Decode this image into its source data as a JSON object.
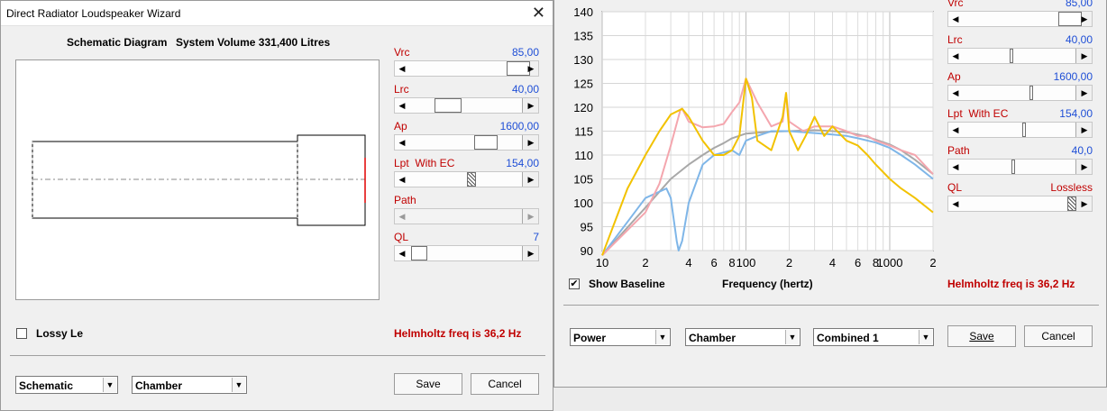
{
  "left": {
    "title": "Direct Radiator Loudspeaker Wizard",
    "diagram_label": "Schematic Diagram",
    "system_volume": "System Volume 331,400 Litres",
    "params": [
      {
        "label": "Vrc",
        "value": "85,00"
      },
      {
        "label": "Lrc",
        "value": "40,00"
      },
      {
        "label": "Ap",
        "value": "1600,00"
      },
      {
        "label": "Lpt  With EC",
        "value": "154,00"
      },
      {
        "label": "Path",
        "value": ""
      },
      {
        "label": "QL",
        "value": "7"
      }
    ],
    "lossy_label": "Lossy Le",
    "helmholtz": "Helmholtz freq is 36,2 Hz",
    "combo1": "Schematic",
    "combo2": "Chamber",
    "save": "Save",
    "cancel": "Cancel"
  },
  "right": {
    "params": [
      {
        "label": "Vrc",
        "value": "85,00"
      },
      {
        "label": "Lrc",
        "value": "40,00"
      },
      {
        "label": "Ap",
        "value": "1600,00"
      },
      {
        "label": "Lpt  With EC",
        "value": "154,00"
      },
      {
        "label": "Path",
        "value": "40,0"
      },
      {
        "label": "QL",
        "value": "Lossless"
      }
    ],
    "show_baseline": "Show Baseline",
    "xlabel": "Frequency (hertz)",
    "helmholtz": "Helmholtz freq is 36,2 Hz",
    "combo1": "Power",
    "combo2": "Chamber",
    "combo3": "Combined 1",
    "save": "Save",
    "cancel": "Cancel"
  },
  "chart_data": {
    "type": "line",
    "title": "",
    "xlabel": "Frequency (hertz)",
    "ylabel": "",
    "x_scale": "log",
    "xlim": [
      10,
      2000
    ],
    "ylim": [
      90,
      140
    ],
    "y_ticks": [
      "140",
      "135",
      "130",
      "125",
      "120",
      "115",
      "110",
      "105",
      "100",
      "95",
      "90"
    ],
    "x_ticks": [
      "10",
      "2",
      "4",
      "6",
      "8",
      "100",
      "2",
      "4",
      "6",
      "8",
      "1000",
      "2"
    ],
    "grid": true,
    "colors": {
      "gold": "#f2c200",
      "pink": "#f4a6ae",
      "blue": "#7fb6e8",
      "gray": "#a8a8a8"
    },
    "series": [
      {
        "color": "gold",
        "x": [
          10,
          15,
          20,
          25,
          30,
          35,
          36,
          40,
          50,
          60,
          70,
          80,
          90,
          100,
          110,
          120,
          150,
          180,
          190,
          200,
          230,
          260,
          300,
          350,
          400,
          500,
          600,
          700,
          800,
          1000,
          1200,
          1500,
          2000
        ],
        "y": [
          89,
          103,
          110,
          115,
          118.5,
          119.5,
          119.7,
          118,
          113,
          110,
          110,
          111,
          114,
          126,
          122,
          113,
          111,
          118,
          123,
          115,
          111,
          114,
          118,
          114,
          116,
          113,
          112,
          110,
          108,
          105,
          103,
          101,
          98
        ]
      },
      {
        "color": "pink",
        "x": [
          10,
          20,
          25,
          30,
          35,
          36,
          40,
          50,
          60,
          70,
          80,
          90,
          100,
          120,
          150,
          180,
          190,
          200,
          250,
          300,
          400,
          500,
          600,
          700,
          800,
          1000,
          1200,
          1500,
          2000
        ],
        "y": [
          89,
          98,
          104,
          112,
          119.5,
          119.7,
          117,
          115.8,
          116,
          116.5,
          119,
          121,
          126,
          121,
          116,
          117,
          123,
          117,
          115,
          116,
          116,
          115,
          114,
          114,
          113,
          112,
          111,
          110,
          106
        ]
      },
      {
        "color": "blue",
        "x": [
          10,
          15,
          20,
          28,
          30,
          33,
          34,
          36,
          40,
          50,
          60,
          80,
          90,
          100,
          120,
          150,
          200,
          300,
          400,
          500,
          600,
          800,
          1000,
          1200,
          1500,
          2000
        ],
        "y": [
          89,
          96,
          101,
          103,
          101,
          92,
          90,
          92,
          100,
          108,
          110,
          111,
          110,
          113,
          114,
          115,
          115,
          114.6,
          114.3,
          114,
          113.5,
          112.6,
          111.5,
          110,
          108,
          105
        ]
      },
      {
        "color": "gray",
        "x": [
          10,
          20,
          30,
          40,
          50,
          60,
          70,
          80,
          100,
          150,
          200,
          300,
          400,
          500,
          600,
          700,
          800,
          1000,
          1200,
          1500,
          2000
        ],
        "y": [
          89,
          99,
          105,
          108,
          110,
          111.5,
          112.5,
          113.5,
          114.5,
          114.9,
          115,
          115.2,
          115,
          114.8,
          114.3,
          113.8,
          113.2,
          112.2,
          111,
          109,
          106
        ]
      }
    ]
  }
}
